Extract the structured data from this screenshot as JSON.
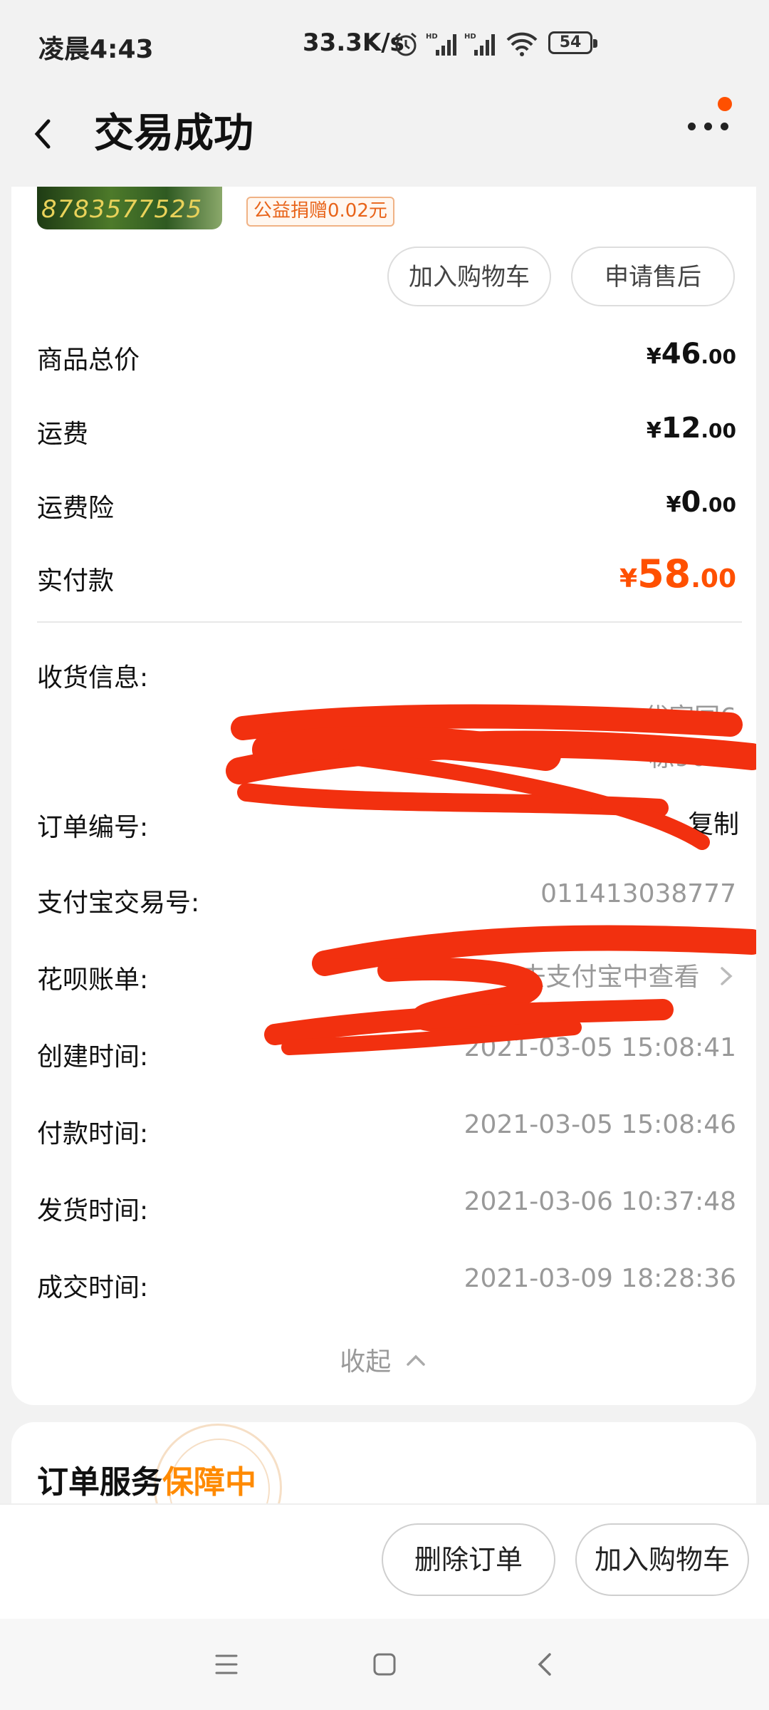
{
  "status_bar": {
    "time": "凌晨4:43",
    "network_speed": "33.3K/s",
    "battery": "54",
    "icons": [
      "alarm-icon",
      "signal-hd-icon",
      "signal-hd-icon",
      "wifi-icon",
      "battery-icon"
    ]
  },
  "header": {
    "title": "交易成功",
    "back_icon": "chevron-left-icon",
    "more_icon": "more-dots-icon",
    "notify_color": "#ff5000"
  },
  "product": {
    "thumb_text": "8783577525",
    "charity_tag": "公益捐赠0.02元",
    "add_cart_label": "加入购物车",
    "after_sale_label": "申请售后"
  },
  "price_rows": [
    {
      "label": "商品总价",
      "currency": "¥",
      "int": "46",
      "dec": ".00"
    },
    {
      "label": "运费",
      "currency": "¥",
      "int": "12",
      "dec": ".00"
    },
    {
      "label": "运费险",
      "currency": "¥",
      "int": "0",
      "dec": ".00"
    },
    {
      "label": "实付款",
      "currency": "¥",
      "int": "58",
      "dec": ".00",
      "color": "#ff5000"
    }
  ],
  "info": {
    "shipping_label": "收货信息:",
    "shipping_line2_tail": "代家园6",
    "shipping_line3": "栋902",
    "order_no_label": "订单编号:",
    "copy_label": "复制",
    "alipay_label": "支付宝交易号:",
    "alipay_tail": "011413038777",
    "huabei_label": "花呗账单:",
    "huabei_value": "去支付宝中查看",
    "created_label": "创建时间:",
    "created_value": "2021-03-05 15:08:41",
    "paid_label": "付款时间:",
    "paid_value": "2021-03-05 15:08:46",
    "shipped_label": "发货时间:",
    "shipped_value": "2021-03-06 10:37:48",
    "closed_label": "成交时间:",
    "closed_value": "2021-03-09 18:28:36",
    "collapse_label": "收起"
  },
  "service": {
    "title": "订单服务",
    "status": "保障中"
  },
  "actions": {
    "delete_label": "删除订单",
    "cart_label": "加入购物车"
  },
  "colors": {
    "accent": "#ff5000",
    "guarantee": "#ff8a00",
    "scribble": "#f2300f"
  }
}
